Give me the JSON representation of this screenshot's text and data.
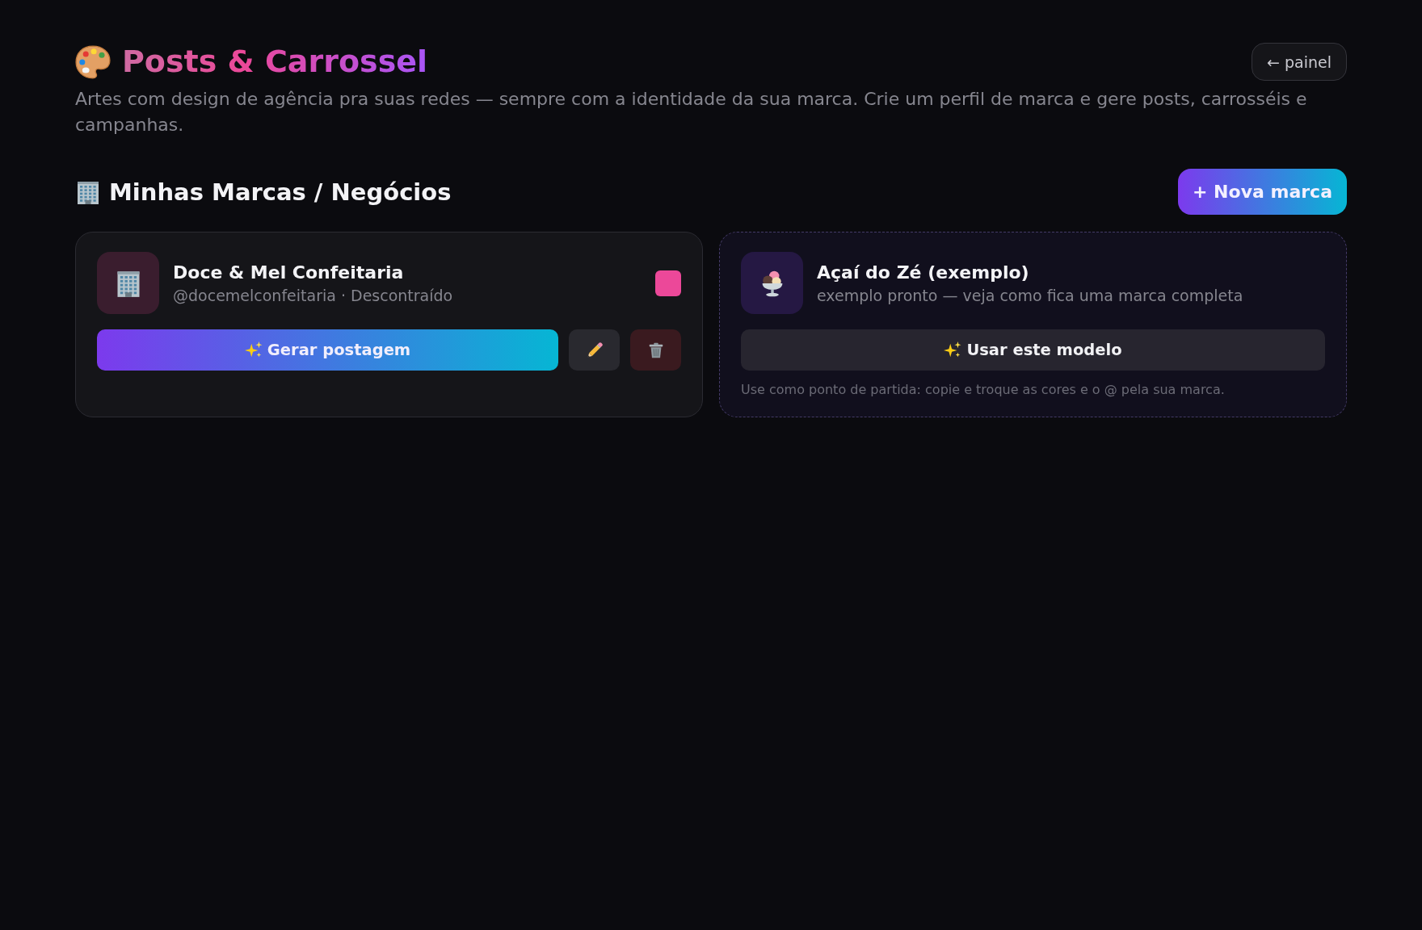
{
  "header": {
    "title": "Posts & Carrossel",
    "subtitle": "Artes com design de agência pra suas redes — sempre com a identidade da sua marca. Crie um perfil de marca e gere posts, carrosséis e campanhas.",
    "back_button": "← painel"
  },
  "section": {
    "title": "Minhas Marcas / Negócios",
    "new_button": "+ Nova marca"
  },
  "brands": [
    {
      "kind": "brand",
      "name": "Doce & Mel Confeitaria",
      "subtitle": "@docemelconfeitaria · Descontraído",
      "color": "#ec4899",
      "primary_button": "Gerar postagem"
    },
    {
      "kind": "example",
      "name": "Açaí do Zé (exemplo)",
      "subtitle": "exemplo pronto — veja como fica uma marca completa",
      "primary_button": "Usar este modelo",
      "note": "Use como ponto de partida: copie e troque as cores e o @ pela sua marca."
    }
  ]
}
